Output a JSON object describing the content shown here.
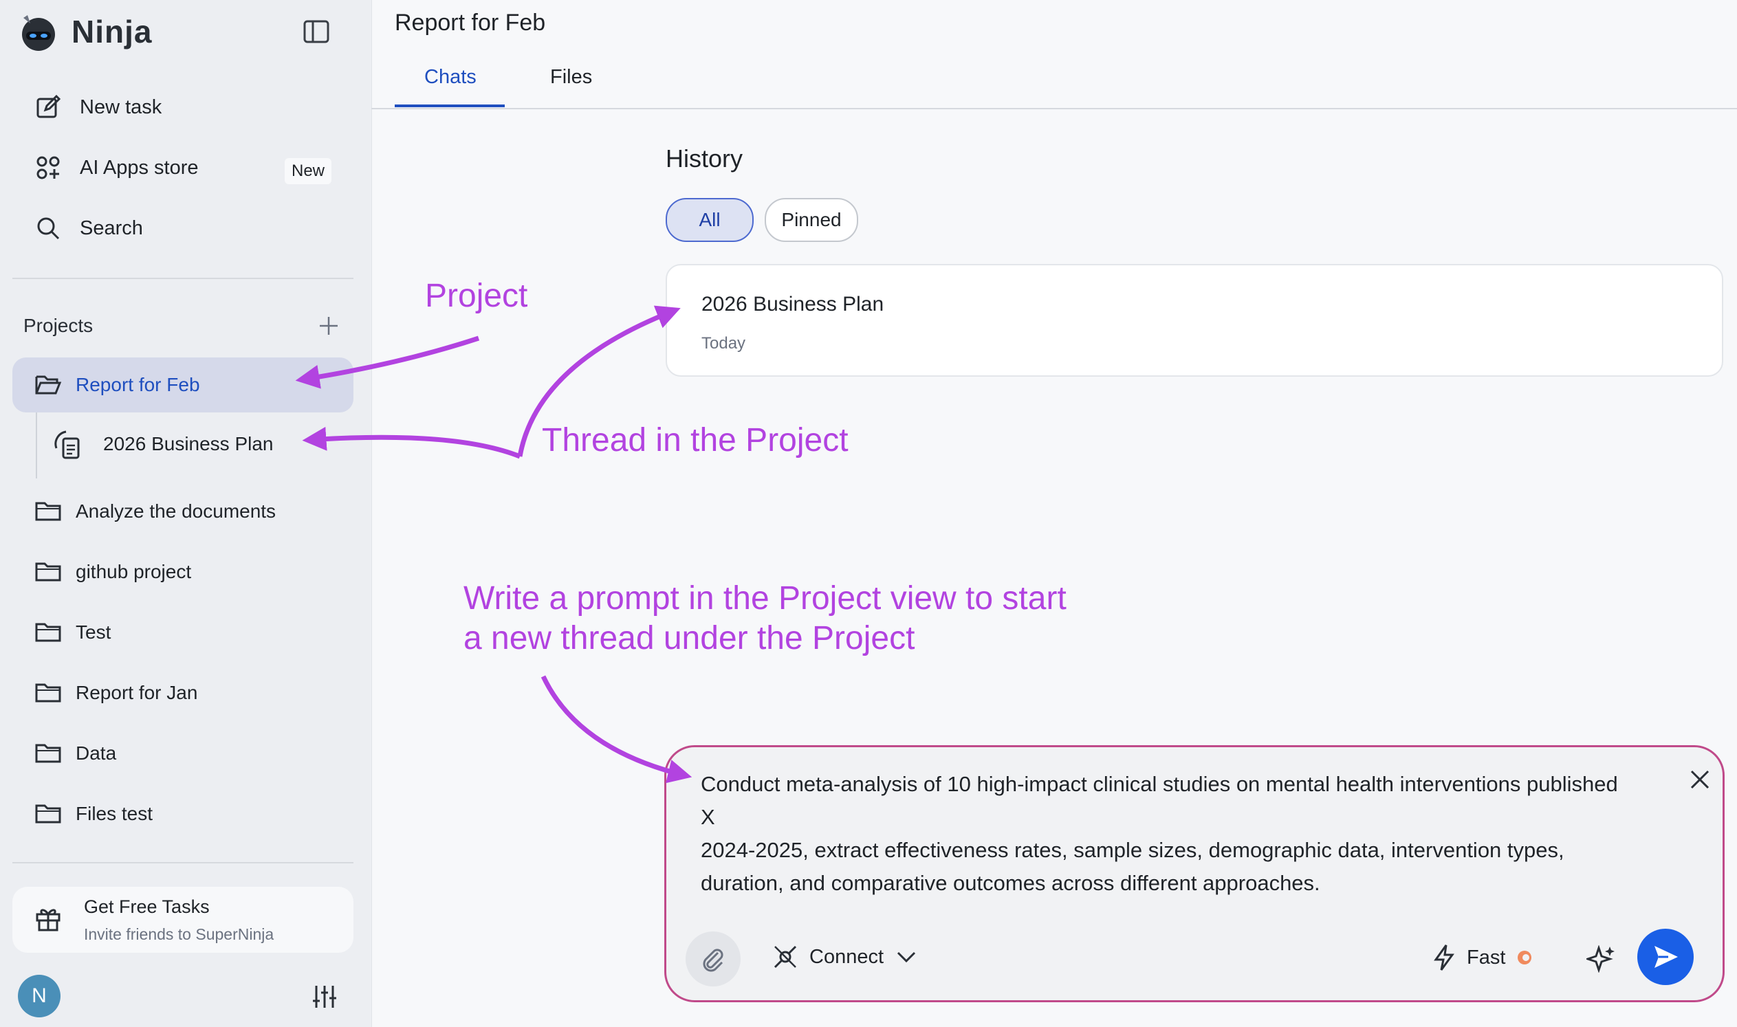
{
  "sidebar": {
    "logo": "Ninja",
    "nav": [
      {
        "label": "New task",
        "icon": "edit-icon"
      },
      {
        "label": "AI Apps store",
        "icon": "apps-icon",
        "badge": "New"
      },
      {
        "label": "Search",
        "icon": "search-icon"
      }
    ],
    "projects_label": "Projects",
    "projects": [
      {
        "label": "Report for Feb",
        "active": true
      },
      {
        "label": "Analyze the documents"
      },
      {
        "label": "github project"
      },
      {
        "label": "Test"
      },
      {
        "label": "Report for Jan"
      },
      {
        "label": "Data"
      },
      {
        "label": "Files test"
      }
    ],
    "thread": {
      "label": "2026 Business Plan"
    },
    "promo": {
      "title": "Get Free Tasks",
      "subtitle": "Invite friends to SuperNinja"
    },
    "avatar_initial": "N"
  },
  "main": {
    "title": "Report for Feb",
    "tabs": [
      {
        "label": "Chats",
        "active": true
      },
      {
        "label": "Files"
      }
    ],
    "history": {
      "title": "History",
      "filters": [
        "All",
        "Pinned"
      ],
      "items": [
        {
          "title": "2026 Business Plan",
          "date": "Today"
        }
      ]
    }
  },
  "composer": {
    "prompt_line1": "Conduct meta-analysis of 10 high-impact clinical studies on mental health interventions published",
    "prompt_line2": "X",
    "prompt_line3": "2024-2025, extract effectiveness rates, sample sizes, demographic data, intervention types,",
    "prompt_line4": "duration, and comparative outcomes across different approaches.",
    "connect_label": "Connect",
    "mode_label": "Fast"
  },
  "annotations": {
    "project": "Project",
    "thread": "Thread in the Project",
    "prompt_line1": "Write a prompt in the Project view to start",
    "prompt_line2": "a new thread under the Project"
  },
  "colors": {
    "accent": "#1f4fbf",
    "annotation": "#b243e0",
    "send": "#1a5fe6",
    "composer_border": "#c04a8a"
  }
}
